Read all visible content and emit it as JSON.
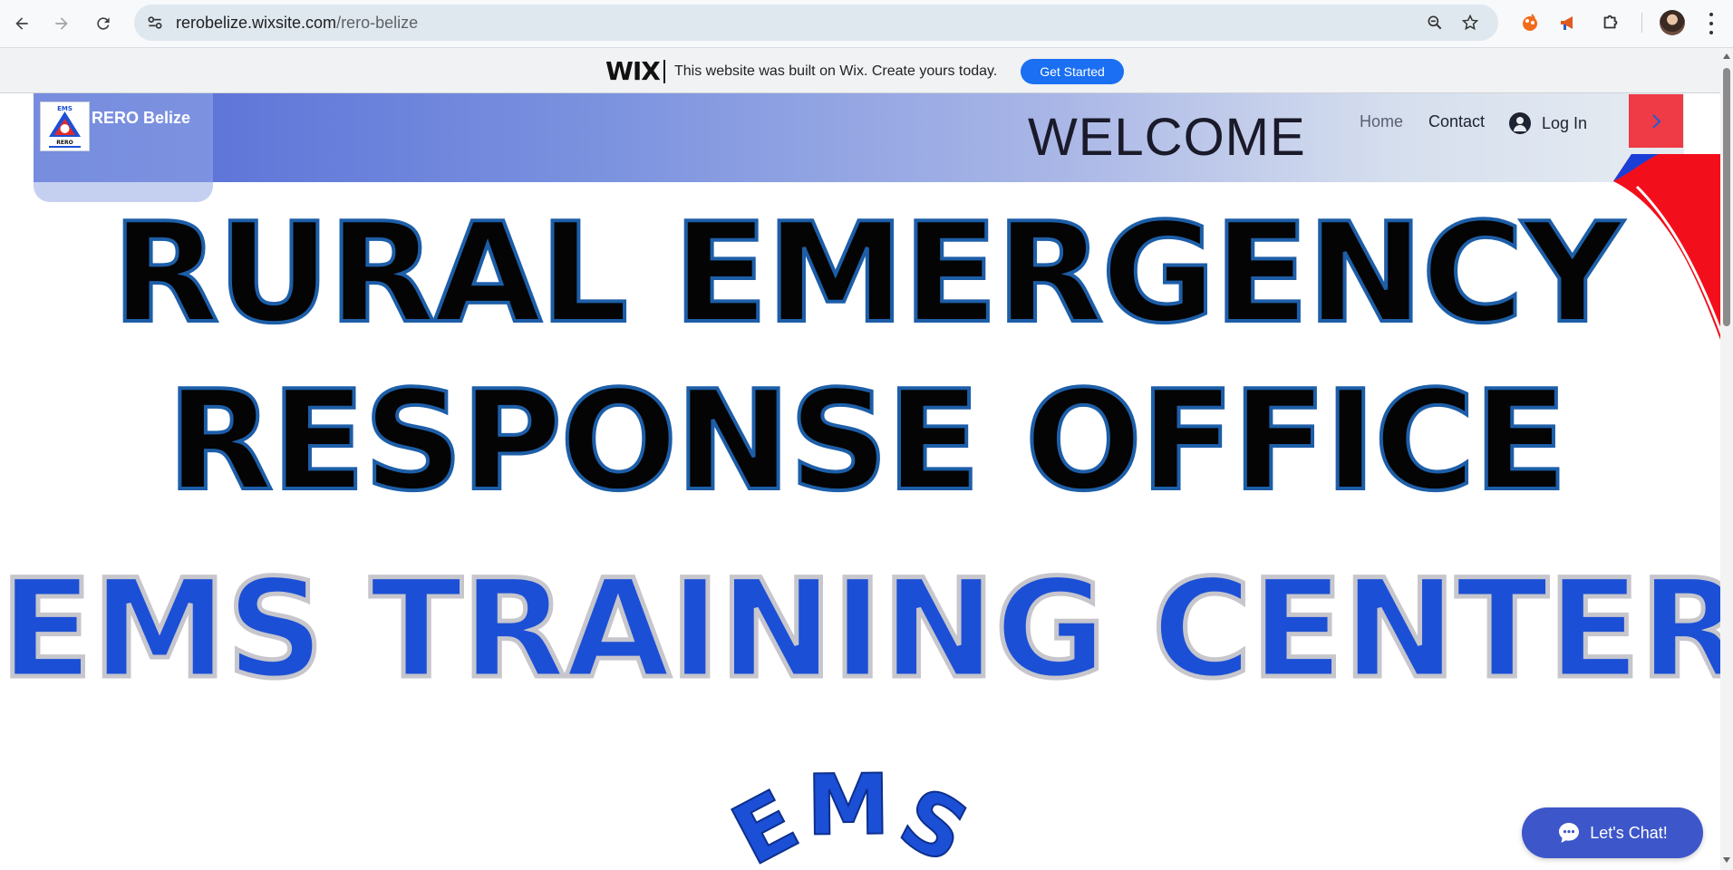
{
  "browser": {
    "url_domain": "rerobelize.wixsite.com",
    "url_path": "/rero-belize",
    "icons": [
      "back-arrow-icon",
      "forward-arrow-icon",
      "reload-icon",
      "site-info-icon",
      "zoom-icon",
      "star-icon",
      "extension-icon",
      "megaphone-icon",
      "puzzle-icon",
      "profile-avatar",
      "more-menu-icon"
    ]
  },
  "wix_banner": {
    "logo": "WIX",
    "text": "This website was built on Wix. Create yours today.",
    "cta": "Get Started",
    "cta_color": "#1a6ff2"
  },
  "header": {
    "site_title": "RERO Belize",
    "welcome": "WELCOME",
    "nav": {
      "home": "Home",
      "contact": "Contact",
      "login": "Log In"
    },
    "accent_red": "#ee3b45",
    "gradient_start": "#5269d6"
  },
  "hero": {
    "line1": "RURAL EMERGENCY",
    "line2": "RESPONSE OFFICE",
    "line3": "EMS TRAINING CENTER",
    "ems_art_text": "EMS",
    "line3_color": "#1b4fd6"
  },
  "chat": {
    "label": "Let's Chat!",
    "color": "#3d56c9"
  }
}
